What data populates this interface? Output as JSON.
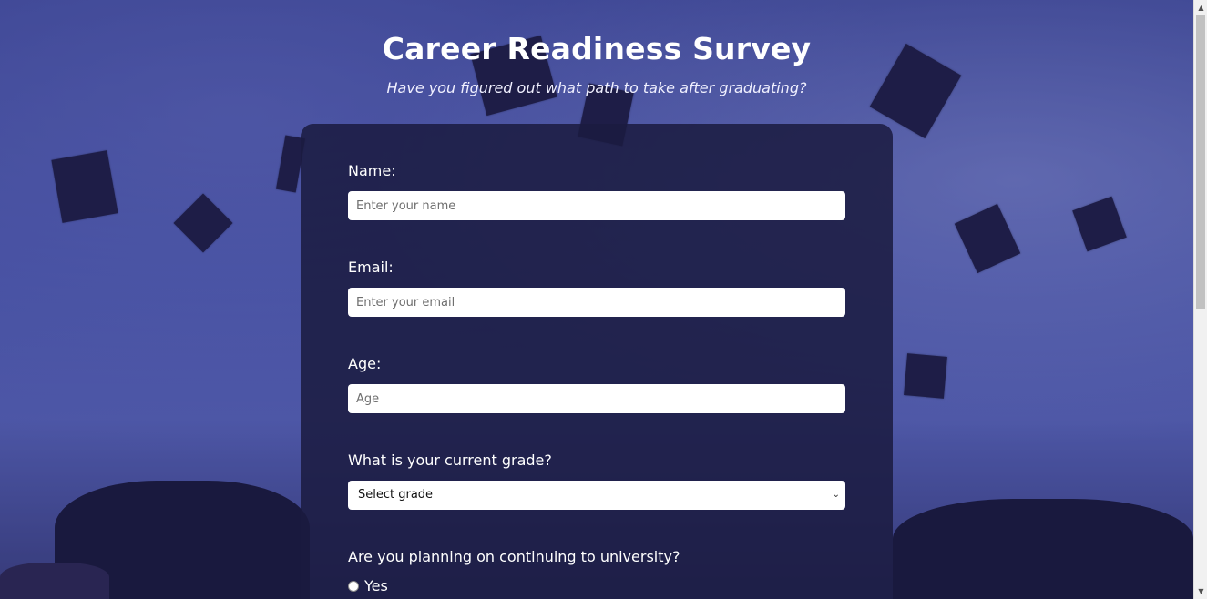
{
  "header": {
    "title": "Career Readiness Survey",
    "subtitle": "Have you figured out what path to take after graduating?"
  },
  "form": {
    "name": {
      "label": "Name:",
      "placeholder": "Enter your name",
      "value": ""
    },
    "email": {
      "label": "Email:",
      "placeholder": "Enter your email",
      "value": ""
    },
    "age": {
      "label": "Age:",
      "placeholder": "Age",
      "value": ""
    },
    "grade": {
      "label": "What is your current grade?",
      "selected": "Select grade"
    },
    "university": {
      "label": "Are you planning on continuing to university?",
      "options": [
        {
          "label": "Yes",
          "checked": false
        }
      ]
    }
  },
  "colors": {
    "card": "#1b1b40",
    "background": "#4a5aa8",
    "text": "#ffffff"
  },
  "icons": {
    "select_chevron": "chevron-down-icon",
    "scroll_up": "scroll-up-arrow-icon",
    "scroll_down": "scroll-down-arrow-icon"
  }
}
